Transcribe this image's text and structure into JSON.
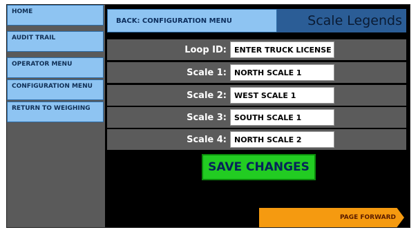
{
  "sidebar": {
    "items": [
      {
        "label": "HOME"
      },
      {
        "label": "AUDIT TRAIL"
      },
      {
        "label": "OPERATOR MENU"
      },
      {
        "label": "CONFIGURATION MENU"
      },
      {
        "label": "RETURN TO WEIGHING"
      }
    ]
  },
  "header": {
    "back_label": "BACK: CONFIGURATION MENU",
    "title": "Scale Legends"
  },
  "form": {
    "rows": [
      {
        "label": "Loop ID:",
        "value": "ENTER TRUCK LICENSE"
      },
      {
        "label": "Scale 1:",
        "value": "NORTH SCALE 1"
      },
      {
        "label": "Scale 2:",
        "value": "WEST SCALE 1"
      },
      {
        "label": "Scale 3:",
        "value": "SOUTH SCALE 1"
      },
      {
        "label": "Scale 4:",
        "value": "NORTH SCALE 2"
      }
    ]
  },
  "actions": {
    "save_label": "SAVE CHANGES",
    "page_forward_label": "PAGE FORWARD"
  },
  "colors": {
    "nav_button": "#8ec4f2",
    "title_bar": "#2b5d96",
    "save_button": "#22cc22",
    "page_forward": "#f59a10",
    "row_background": "#5b5b5b"
  }
}
